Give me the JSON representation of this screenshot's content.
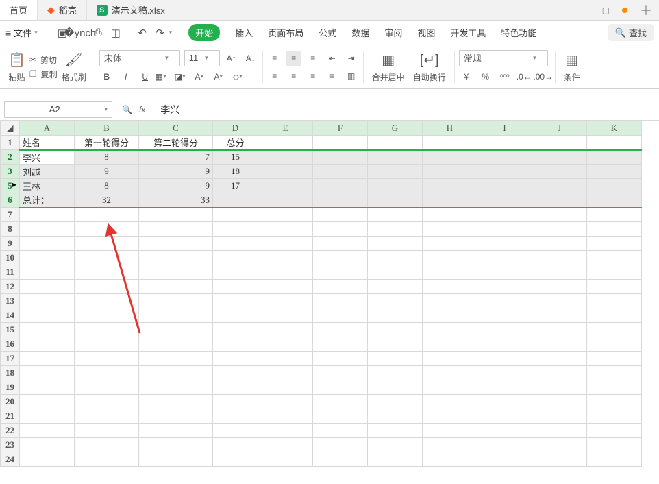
{
  "tabs": {
    "home": "首页",
    "daoke": "稻壳",
    "doc": "演示文稿.xlsx"
  },
  "menubar": {
    "file": "文件"
  },
  "ribbon": {
    "start": "开始",
    "insert": "插入",
    "layout": "页面布局",
    "formula": "公式",
    "data": "数据",
    "review": "审阅",
    "view": "视图",
    "dev": "开发工具",
    "special": "特色功能",
    "search": "查找"
  },
  "toolbar": {
    "paste": "粘贴",
    "cut": "剪切",
    "copy": "复制",
    "format_painter": "格式刷",
    "font_name": "宋体",
    "font_size": "11",
    "merge": "合并居中",
    "wrap": "自动换行",
    "num_format": "常规",
    "cond": "条件"
  },
  "fx": {
    "cell_ref": "A2",
    "value": "李兴"
  },
  "columns": [
    "A",
    "B",
    "C",
    "D",
    "E",
    "F",
    "G",
    "H",
    "I",
    "J",
    "K"
  ],
  "header_row": {
    "name": "姓名",
    "r1": "第一轮得分",
    "r2": "第二轮得分",
    "total": "总分"
  },
  "rows": [
    {
      "name": "李兴",
      "r1": "8",
      "r2": "7",
      "total": "15"
    },
    {
      "name": "刘越",
      "r1": "9",
      "r2": "9",
      "total": "18"
    },
    {
      "name": "王林",
      "r1": "8",
      "r2": "9",
      "total": "17"
    },
    {
      "name": "总计：",
      "r1": "32",
      "r2": "33",
      "total": ""
    }
  ],
  "row_labels": [
    "1",
    "2",
    "3",
    "5",
    "6",
    "7",
    "8",
    "9",
    "10",
    "11",
    "12",
    "13",
    "14",
    "15",
    "16",
    "17",
    "18",
    "19",
    "20",
    "21",
    "22",
    "23",
    "24"
  ]
}
